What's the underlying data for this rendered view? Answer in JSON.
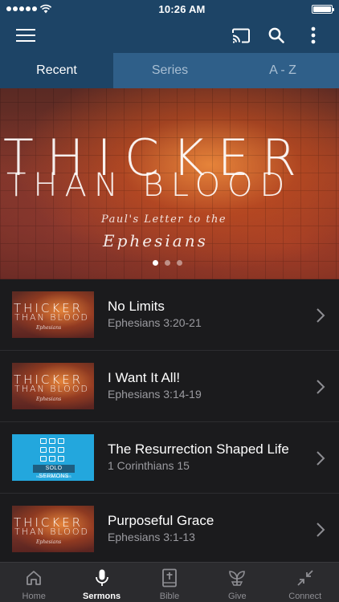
{
  "status_bar": {
    "time": "10:26 AM",
    "battery_percent": 100
  },
  "nav": {
    "icons": [
      "menu-icon",
      "cast-icon",
      "search-icon",
      "more-vertical-icon"
    ]
  },
  "tabs": [
    {
      "label": "Recent",
      "active": true
    },
    {
      "label": "Series",
      "active": false
    },
    {
      "label": "A - Z",
      "active": false
    }
  ],
  "hero": {
    "title_line1": "THICKER",
    "title_line2": "THAN BLOOD",
    "subtitle_line1": "Paul's Letter to the",
    "subtitle_line2": "Ephesians",
    "page_count": 3,
    "current_page": 1
  },
  "thumb_art": {
    "tcb_line1": "THICKER",
    "tcb_line2": "THAN BLOOD",
    "tcb_line3": "Ephesians",
    "solo_label": "SOLO SERMONS",
    "solo_tag": "NOT FROM A SERIES"
  },
  "sermons": [
    {
      "title": "No Limits",
      "reference": "Ephesians 3:20-21",
      "thumbnail": "thicker-than-blood"
    },
    {
      "title": "I Want It All!",
      "reference": "Ephesians 3:14-19",
      "thumbnail": "thicker-than-blood"
    },
    {
      "title": "The Resurrection Shaped Life",
      "reference": "1 Corinthians 15",
      "thumbnail": "solo-sermons"
    },
    {
      "title": "Purposeful Grace",
      "reference": "Ephesians 3:1-13",
      "thumbnail": "thicker-than-blood"
    }
  ],
  "tab_bar": [
    {
      "label": "Home",
      "icon": "home-icon",
      "active": false
    },
    {
      "label": "Sermons",
      "icon": "microphone-icon",
      "active": true
    },
    {
      "label": "Bible",
      "icon": "bible-icon",
      "active": false
    },
    {
      "label": "Give",
      "icon": "plant-icon",
      "active": false
    },
    {
      "label": "Connect",
      "icon": "arrows-in-icon",
      "active": false
    }
  ],
  "colors": {
    "nav_bg": "#1d4466",
    "tab_inactive_bg": "#2f5f89",
    "list_bg": "#1b1b1d",
    "tab_bar_bg": "#2b2b2e"
  }
}
